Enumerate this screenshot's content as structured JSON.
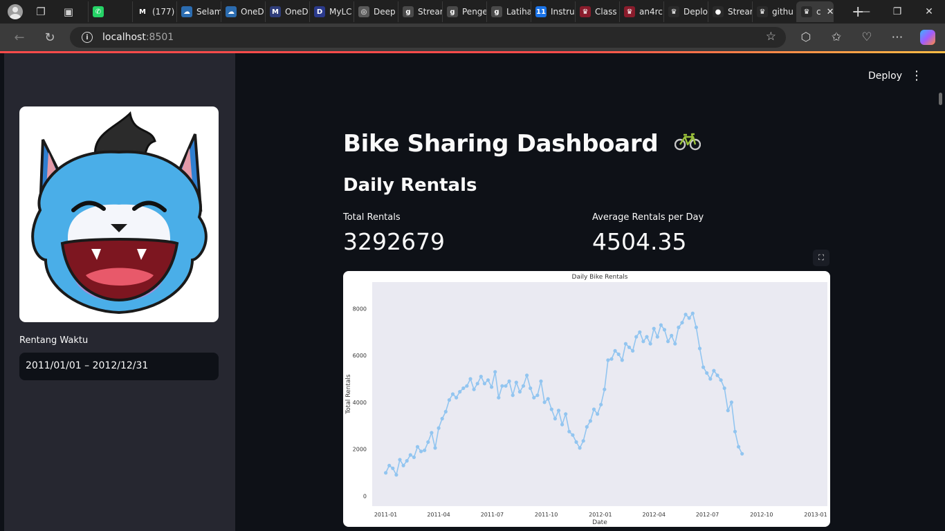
{
  "browser": {
    "tabs": [
      {
        "label": "",
        "icon": "whatsapp-icon",
        "color": "#25d366",
        "glyph": "✆"
      },
      {
        "label": "(177)",
        "icon": "gmail-icon",
        "color": "#1f1f1f",
        "glyph": "M"
      },
      {
        "label": "Selam",
        "icon": "onedrive-icon",
        "color": "#2b6cb0",
        "glyph": "☁"
      },
      {
        "label": "OneD",
        "icon": "onedrive-icon",
        "color": "#2b6cb0",
        "glyph": "☁"
      },
      {
        "label": "OneD",
        "icon": "mylc-icon",
        "color": "#2f3d7a",
        "glyph": "M"
      },
      {
        "label": "MyLC",
        "icon": "deepl-icon",
        "color": "#2b3a8c",
        "glyph": "D"
      },
      {
        "label": "Deep",
        "icon": "streamlit-icon",
        "color": "#5a5a5a",
        "glyph": "◎"
      },
      {
        "label": "Strean",
        "icon": "gitbook-icon",
        "color": "#4a4a4a",
        "glyph": "g"
      },
      {
        "label": "Penge",
        "icon": "gitbook-icon",
        "color": "#4a4a4a",
        "glyph": "g"
      },
      {
        "label": "Latiha",
        "icon": "gitbook-icon",
        "color": "#4a4a4a",
        "glyph": "g"
      },
      {
        "label": "Instru",
        "icon": "calendar-icon",
        "color": "#1a73e8",
        "glyph": "11"
      },
      {
        "label": "Class",
        "icon": "crown-icon",
        "color": "#8a1c2c",
        "glyph": "♛"
      },
      {
        "label": "an4rc",
        "icon": "crown-icon",
        "color": "#8a1c2c",
        "glyph": "♛"
      },
      {
        "label": "Deplo",
        "icon": "streamlit-crown-icon",
        "color": "#2a2a2a",
        "glyph": "♛"
      },
      {
        "label": "Strean",
        "icon": "github-icon",
        "color": "#2a2a2a",
        "glyph": "●"
      },
      {
        "label": "githu",
        "icon": "streamlit-crown-icon",
        "color": "#2a2a2a",
        "glyph": "♛"
      }
    ],
    "active_tab_label": "c",
    "url_host": "localhost",
    "url_port": ":8501"
  },
  "sidebar": {
    "date_label": "Rentang Waktu",
    "date_value": "2011/01/01 – 2012/12/31"
  },
  "header": {
    "deploy_label": "Deploy",
    "menu_glyph": "⋮"
  },
  "main": {
    "title": "Bike Sharing Dashboard",
    "subheader": "Daily Rentals",
    "metrics": [
      {
        "label": "Total Rentals",
        "value": "3292679"
      },
      {
        "label": "Average Rentals per Day",
        "value": "4504.35"
      }
    ]
  },
  "chart_data": {
    "type": "line",
    "title": "Daily Bike Rentals",
    "xlabel": "Date",
    "ylabel": "Total Rentals",
    "x_ticks": [
      "2011-01",
      "2011-04",
      "2011-07",
      "2011-10",
      "2012-01",
      "2012-04",
      "2012-07",
      "2012-10",
      "2013-01"
    ],
    "y_ticks": [
      0,
      2000,
      4000,
      6000,
      8000
    ],
    "xlim": [
      "2010-12-09",
      "2013-01-21"
    ],
    "ylim": [
      -435,
      9135
    ],
    "grid": false,
    "series": [
      {
        "color": "#92c5f0",
        "x_start": "2011-01-01",
        "interval_days": 6,
        "values": [
          985,
          1300,
          1180,
          900,
          1550,
          1300,
          1500,
          1750,
          1650,
          2100,
          1900,
          1950,
          2300,
          2700,
          2050,
          2900,
          3300,
          3600,
          4100,
          4350,
          4200,
          4450,
          4600,
          4700,
          5000,
          4550,
          4800,
          5100,
          4800,
          4950,
          4650,
          5300,
          4200,
          4700,
          4700,
          4900,
          4300,
          4850,
          4450,
          4700,
          5150,
          4600,
          4200,
          4300,
          4900,
          4000,
          4150,
          3700,
          3300,
          3650,
          3050,
          3500,
          2750,
          2600,
          2300,
          2050,
          2350,
          2950,
          3200,
          3700,
          3500,
          3900,
          4550,
          5800,
          5850,
          6200,
          6050,
          5800,
          6500,
          6350,
          6200,
          6800,
          7000,
          6600,
          6800,
          6500,
          7150,
          6800,
          7300,
          7100,
          6600,
          6850,
          6500,
          7200,
          7400,
          7750,
          7600,
          7800,
          7200,
          6300,
          5500,
          5250,
          5000,
          5350,
          5150,
          4950,
          4600,
          3650,
          4000,
          2750,
          2100,
          1800
        ]
      }
    ]
  }
}
